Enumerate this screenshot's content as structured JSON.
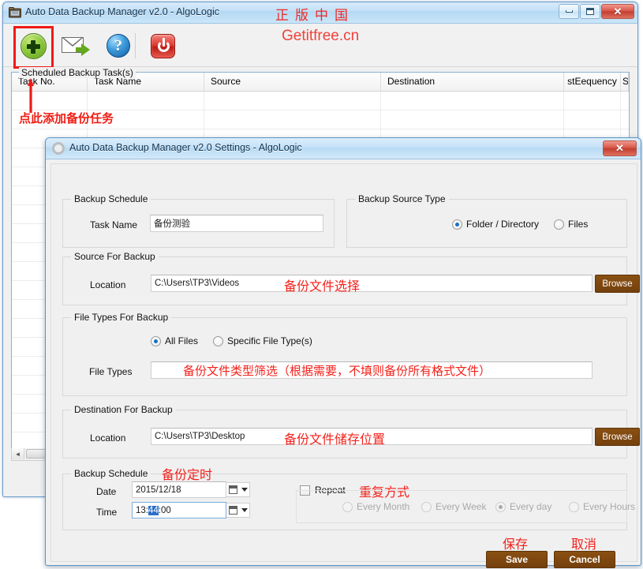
{
  "main_window": {
    "title": "Auto Data Backup Manager v2.0 - AlgoLogic",
    "app_icon": "backup-app-icon",
    "window_controls": {
      "minimize": "minimize-button",
      "maximize": "maximize-button",
      "close": "✕"
    },
    "toolbar": {
      "buttons": [
        {
          "name": "add-task-button",
          "icon": "green-plus-icon"
        },
        {
          "name": "email-button",
          "icon": "envelope-send-icon"
        },
        {
          "name": "help-button",
          "icon": "question-mark-icon",
          "glyph": "?"
        },
        {
          "name": "exit-button",
          "icon": "power-icon"
        }
      ]
    },
    "group_label": "Scheduled Backup Task(s)",
    "table": {
      "columns": [
        "Task No.",
        "Task Name",
        "Source",
        "Destination",
        "stEequency",
        "S"
      ],
      "rows": []
    },
    "scrollbar": {
      "left_arrow": "◄"
    }
  },
  "watermark": {
    "seal_text": "正版中国",
    "url": "Getitfree.cn"
  },
  "annotations": {
    "add_task": "点此添加备份任务",
    "source_select": "备份文件选择",
    "file_types": "备份文件类型筛选（根据需要，不填则备份所有格式文件）",
    "destination": "备份文件储存位置",
    "schedule": "备份定时",
    "repeat": "重复方式",
    "save": "保存",
    "cancel": "取消"
  },
  "dialog": {
    "title": "Auto Data Backup Manager v2.0 Settings - AlgoLogic",
    "icon": "gear-icon",
    "close_label": "✕",
    "backup_schedule_top": {
      "group_label": "Backup Schedule",
      "task_name_label": "Task Name",
      "task_name_value": "备份测验",
      "task_name_placeholder": ""
    },
    "backup_source_type": {
      "group_label": "Backup Source Type",
      "options": [
        {
          "label": "Folder / Directory",
          "selected": true
        },
        {
          "label": "Files",
          "selected": false
        }
      ]
    },
    "source_for_backup": {
      "group_label": "Source For Backup",
      "location_label": "Location",
      "location_value": "C:\\Users\\TP3\\Videos",
      "browse_label": "Browse"
    },
    "file_types_for_backup": {
      "group_label": "File Types For Backup",
      "options": [
        {
          "label": "All Files",
          "selected": true
        },
        {
          "label": "Specific File Type(s)",
          "selected": false
        }
      ],
      "file_types_label": "File Types",
      "file_types_value": ""
    },
    "destination_for_backup": {
      "group_label": "Destination For Backup",
      "location_label": "Location",
      "location_value": "C:\\Users\\TP3\\Desktop",
      "browse_label": "Browse"
    },
    "backup_schedule_bottom": {
      "group_label": "Backup Schedule",
      "date_label": "Date",
      "date_value": "2015/12/18",
      "time_label": "Time",
      "time_value_pre": "13:",
      "time_value_sel": "44",
      "time_value_post": ":00",
      "repeat_label": "Repeat",
      "repeat_checked": false,
      "repeat_options": [
        {
          "label": "Every Month",
          "selected": false
        },
        {
          "label": "Every Week",
          "selected": false
        },
        {
          "label": "Every day",
          "selected": true
        },
        {
          "label": "Every Hours",
          "selected": false
        }
      ]
    },
    "buttons": {
      "save": "Save",
      "cancel": "Cancel"
    }
  },
  "colors": {
    "accent_red": "#f11d14",
    "brown_button": "#8a5013",
    "title_blue": "#b4d8f3",
    "radio_blue": "#1a6fc4"
  }
}
